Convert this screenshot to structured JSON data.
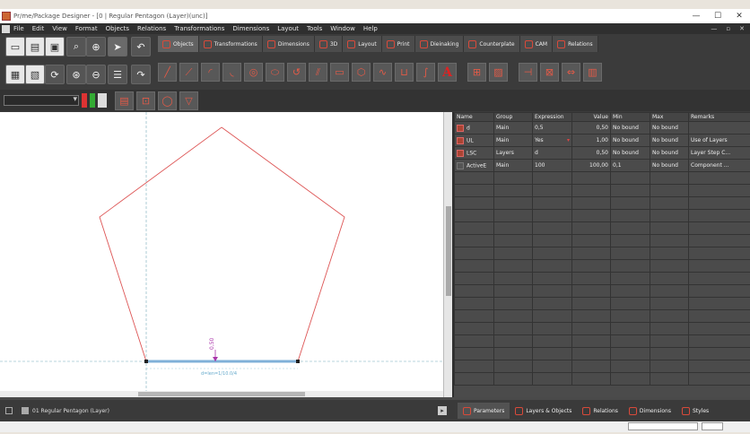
{
  "window": {
    "title": "Pr/me/Package Designer - [0 | Regular Pentagon (Layer)(unc)]",
    "controls": [
      "—",
      "☐",
      "✕"
    ]
  },
  "menu": [
    "File",
    "Edit",
    "View",
    "Format",
    "Objects",
    "Relations",
    "Transformations",
    "Dimensions",
    "Layout",
    "Tools",
    "Window",
    "Help"
  ],
  "menu_right": [
    "—",
    "▫",
    "✕"
  ],
  "tabs": [
    "Objects",
    "Transformations",
    "Dimensions",
    "3D",
    "Layout",
    "Print",
    "Dieinaking",
    "Counterplate",
    "CAM",
    "Relations"
  ],
  "canvas": {
    "dimension_value": "0,50",
    "dimension_label": "d=len=1/10.0/4"
  },
  "grid": {
    "headers": [
      "Name",
      "Group",
      "Expression",
      "Value",
      "Min",
      "Max",
      "Remarks"
    ],
    "rows": [
      [
        "d",
        "Main",
        "0,5",
        "0,50",
        "No bound",
        "No bound",
        ""
      ],
      [
        "UL",
        "Main",
        "Yes",
        "1,00",
        "No bound",
        "No bound",
        "Use of Layers"
      ],
      [
        "LSC",
        "Layers",
        "d",
        "0,50",
        "No bound",
        "No bound",
        "Layer Step C..."
      ],
      [
        "ActiveE",
        "Main",
        "100",
        "100,00",
        "0,1",
        "No bound",
        "Component ..."
      ]
    ]
  },
  "bottom": {
    "layer_label": "01 Regular Pentagon (Layer)",
    "tabs": [
      "Parameters",
      "Layers & Objects",
      "Relations",
      "Dimensions",
      "Styles"
    ]
  },
  "colors": {
    "accent": "#d84a3a",
    "chrome": "#3b3b3b",
    "canvas": "#ffffff"
  }
}
